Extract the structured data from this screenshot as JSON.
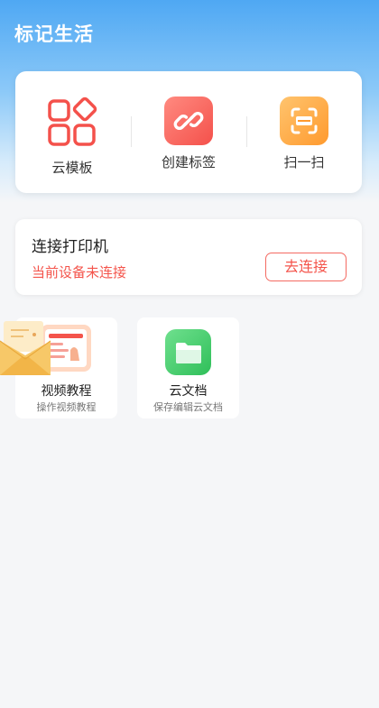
{
  "app": {
    "title": "标记生活"
  },
  "quick_actions": [
    {
      "label": "云模板",
      "icon": "grid-template-icon",
      "color": "#f4514b"
    },
    {
      "label": "创建标签",
      "icon": "link-icon",
      "color": "#f4514b"
    },
    {
      "label": "扫一扫",
      "icon": "scan-icon",
      "color": "#ff9a2e"
    }
  ],
  "printer": {
    "title": "连接打印机",
    "status": "当前设备未连接",
    "connect_label": "去连接"
  },
  "features": [
    {
      "title": "视频教程",
      "subtitle": "操作视频教程",
      "icon": "video-tutorial-icon"
    },
    {
      "title": "云文档",
      "subtitle": "保存编辑云文档",
      "icon": "folder-icon"
    }
  ],
  "colors": {
    "header_blue": "#4fa8f3",
    "accent_red": "#f4544b",
    "accent_orange": "#ff9a2e",
    "accent_green": "#2fbf59"
  }
}
